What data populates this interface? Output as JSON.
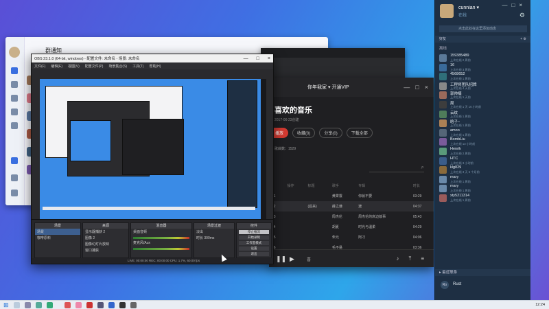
{
  "qq_window": {
    "title": "群通知"
  },
  "music": {
    "user": "你年我家 ▾ 开通VIP",
    "heading": "喜欢的音乐",
    "created": "2017-06-23创建",
    "play_btn": "播放",
    "collect": "收藏(0)",
    "share": "分享(0)",
    "download": "下载全部",
    "count": "歌曲数：1529",
    "columns": [
      "",
      "操作",
      "标题",
      "歌手",
      "专辑",
      "时长"
    ],
    "rows": [
      [
        "01",
        "",
        "",
        "黄霄雲",
        "你就不要",
        "03:29"
      ],
      [
        "02",
        "",
        "(后来)",
        "薛之谦",
        "渡",
        "04:37"
      ],
      [
        "03",
        "",
        "",
        "周杰伦",
        "周杰伦的床边故事",
        "05:43"
      ],
      [
        "04",
        "",
        "",
        "胡夏",
        "时光与温柔",
        "04:29"
      ],
      [
        "05",
        "",
        "",
        "朱元",
        "阿刁",
        "04:06"
      ],
      [
        "06",
        "",
        "",
        "毛不易",
        "",
        "03:36"
      ]
    ],
    "player_text": "喜"
  },
  "obs": {
    "title": "OBS 23.1.0 (64-bit, windows) - 配置文件: 未命名 - 场景: 未命名",
    "menu": [
      "文件(F)",
      "编辑(E)",
      "视图(V)",
      "配置文件(P)",
      "场景集合(S)",
      "工具(T)",
      "帮助(H)"
    ],
    "docks": {
      "scenes": {
        "title": "场景",
        "items": [
          "场景",
          "咖啡原料"
        ]
      },
      "sources": {
        "title": "来源",
        "items": [
          "显示器捕获 2",
          "图像 2",
          "图像幻灯片放映",
          "窗口捕获"
        ]
      },
      "mixer": {
        "title": "混音器",
        "items": [
          "桌面音频",
          "麦克风/Aux"
        ]
      },
      "transitions": {
        "title": "场景过渡",
        "fade": "淡出",
        "duration_label": "时长",
        "duration": "300ms"
      },
      "controls": {
        "title": "控件",
        "buttons": [
          "停止推流",
          "开始录制",
          "工作室模式",
          "设置",
          "退出"
        ]
      }
    },
    "status": "LIVE: 00:00:00   REC: 00:00:00   CPU: 1.7%, 60.00 fps"
  },
  "buddy": {
    "name": "cunnian ▾",
    "status": "在线",
    "note": "点击此处在这里添加动态",
    "header_left": "好友",
    "group": "离线",
    "friends": [
      {
        "name": "159385489",
        "sub": "上次在线 2 周前",
        "color": "#5b7a99"
      },
      {
        "name": "16",
        "sub": "上次在线 3 周前",
        "color": "#3a6b9a"
      },
      {
        "name": "4568652",
        "sub": "上次在线 1 周前",
        "color": "#2f6f7a"
      },
      {
        "name": "工程师团队招牌",
        "sub": "上次在线 4 天前",
        "color": "#888"
      },
      {
        "name": "郭帅楠",
        "sub": "上次在线 1 天前",
        "color": "#9a6a5b"
      },
      {
        "name": "周",
        "sub": "上次在线 1 天 16 小时前",
        "color": "#3d3d3d"
      },
      {
        "name": "云纹",
        "sub": "上次在线 1 周前",
        "color": "#4f7d5a"
      },
      {
        "name": "晗子~",
        "sub": "上次在线 1 周前",
        "color": "#aa8055"
      },
      {
        "name": "amoo",
        "sub": "上次在线 1 周前",
        "color": "#556677"
      },
      {
        "name": "BombLiu",
        "sub": "上次在线 13 小时前",
        "color": "#7a5b9a"
      },
      {
        "name": "Henrik",
        "sub": "上次在线 2 周前",
        "color": "#5a9a7a"
      },
      {
        "name": "HTC",
        "sub": "上次在线 3 小时前",
        "color": "#3b5d8a"
      },
      {
        "name": "klg829",
        "sub": "上次在线 3 天 5 个月前",
        "color": "#8a6a3b"
      },
      {
        "name": "mary",
        "sub": "上次在线 1 周前",
        "color": "#6b8aaa"
      },
      {
        "name": "mary",
        "sub": "上次在线 1 周前",
        "color": "#6b8aaa"
      },
      {
        "name": "xty5211314",
        "sub": "上次在线 1 周前",
        "color": "#9a5b5b"
      }
    ],
    "recent": "▸ 最近联系",
    "rust": "Rust",
    "rust_avatar": "Ro"
  },
  "taskbar": {
    "clock": "12:24"
  }
}
